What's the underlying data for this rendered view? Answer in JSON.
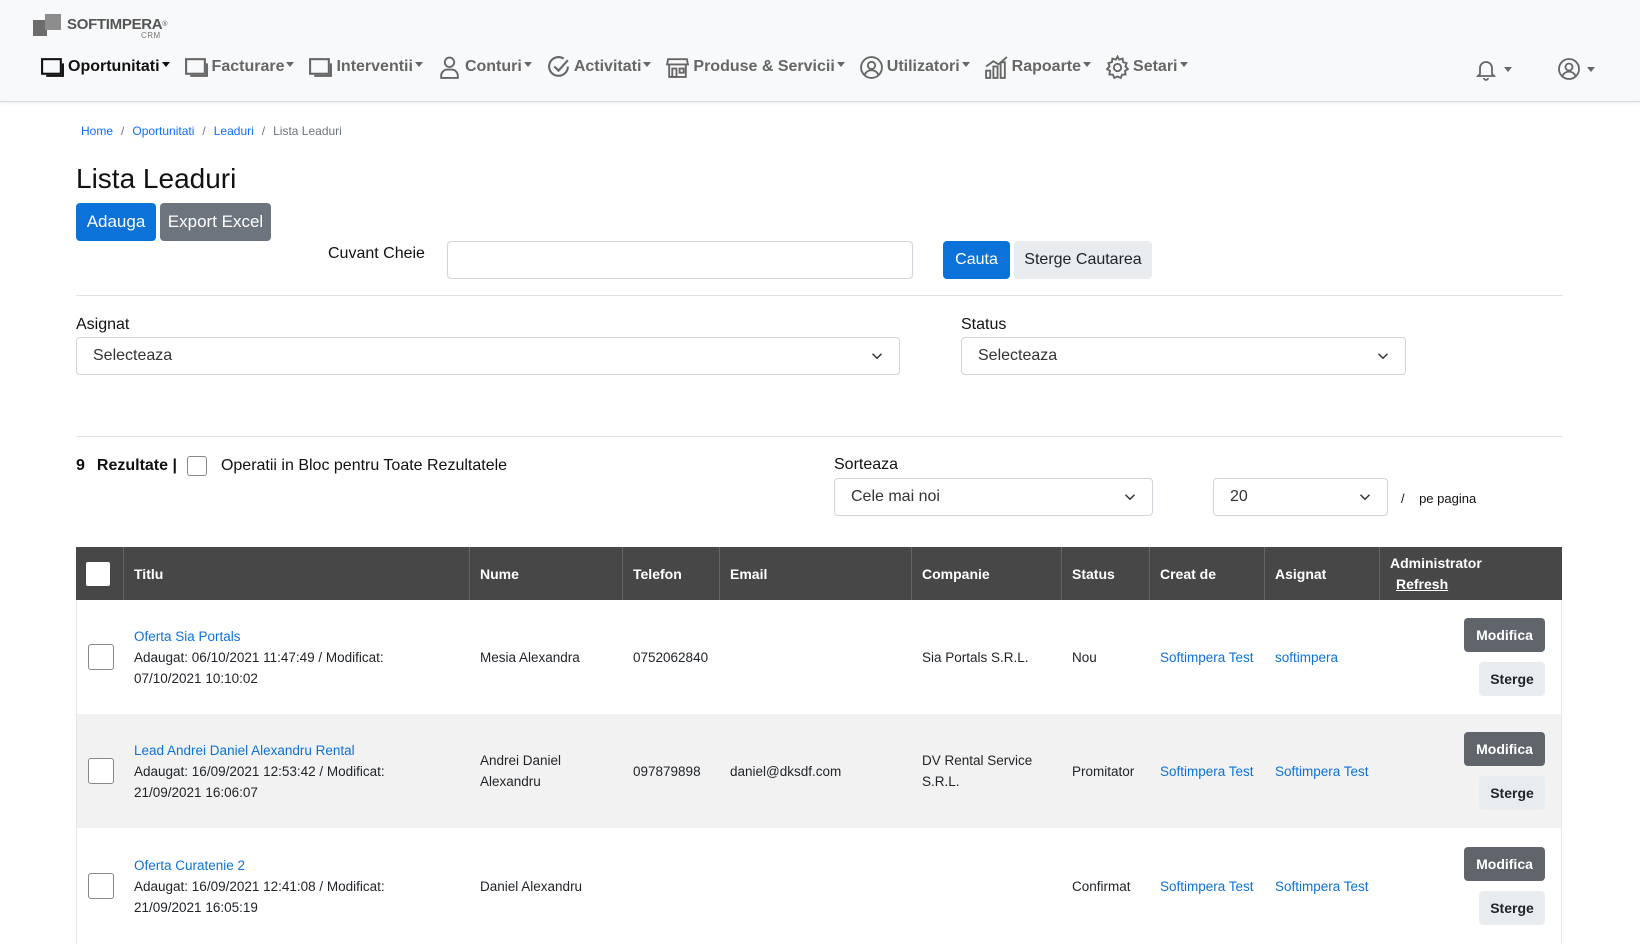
{
  "app": {
    "logo_text": "SOFTIMPERA",
    "logo_reg": "®",
    "logo_sub": "CRM"
  },
  "nav": {
    "items": [
      {
        "label": "Oportunitati",
        "icon": "window-icon",
        "active": true
      },
      {
        "label": "Facturare",
        "icon": "window-icon"
      },
      {
        "label": "Interventii",
        "icon": "window-icon"
      },
      {
        "label": "Conturi",
        "icon": "user-icon"
      },
      {
        "label": "Activitati",
        "icon": "check-circle-icon"
      },
      {
        "label": "Produse & Servicii",
        "icon": "shop-icon"
      },
      {
        "label": "Utilizatori",
        "icon": "user-circle-icon"
      },
      {
        "label": "Rapoarte",
        "icon": "chart-icon"
      },
      {
        "label": "Setari",
        "icon": "gear-icon"
      }
    ]
  },
  "breadcrumb": {
    "home": "Home",
    "oportunitati": "Oportunitati",
    "leaduri": "Leaduri",
    "current": "Lista Leaduri",
    "sep": "/"
  },
  "page": {
    "title": "Lista Leaduri",
    "add_label": "Adauga",
    "export_label": "Export Excel"
  },
  "search": {
    "label": "Cuvant Cheie",
    "value": "",
    "search_label": "Cauta",
    "clear_label": "Sterge Cautarea"
  },
  "filters": {
    "asignat_label": "Asignat",
    "asignat_value": "Selecteaza",
    "status_label": "Status",
    "status_value": "Selecteaza"
  },
  "results": {
    "count": "9",
    "label": "Rezultate |",
    "bulk_label": "Operatii in Bloc pentru Toate Rezultatele",
    "sort_label": "Sorteaza",
    "sort_value": "Cele mai noi",
    "per_page_value": "20",
    "per_page_sep": "/",
    "per_page_label": "pe pagina"
  },
  "table": {
    "headers": {
      "titlu": "Titlu",
      "nume": "Nume",
      "telefon": "Telefon",
      "email": "Email",
      "companie": "Companie",
      "status": "Status",
      "creat_de": "Creat de",
      "asignat": "Asignat",
      "administrator": "Administrator",
      "refresh": "Refresh"
    },
    "rows": [
      {
        "title": "Oferta Sia Portals",
        "meta1": "Adaugat: 06/10/2021 11:47:49 / Modificat:",
        "meta2": "07/10/2021 10:10:02",
        "nume": "Mesia Alexandra",
        "telefon": "0752062840",
        "email": "",
        "companie": "Sia Portals S.R.L.",
        "status": "Nou",
        "creat_de": "Softimpera Test",
        "asignat": "softimpera",
        "modify": "Modifica",
        "delete": "Sterge"
      },
      {
        "title": "Lead Andrei Daniel Alexandru Rental",
        "meta1": "Adaugat: 16/09/2021 12:53:42 / Modificat:",
        "meta2": "21/09/2021 16:06:07",
        "nume": "Andrei Daniel Alexandru",
        "telefon": "097879898",
        "email": "daniel@dksdf.com",
        "companie": "DV Rental Service S.R.L.",
        "status": "Promitator",
        "creat_de": "Softimpera Test",
        "asignat": "Softimpera Test",
        "modify": "Modifica",
        "delete": "Sterge"
      },
      {
        "title": "Oferta Curatenie 2",
        "meta1": "Adaugat: 16/09/2021 12:41:08 / Modificat:",
        "meta2": "21/09/2021 16:05:19",
        "nume": "Daniel Alexandru",
        "telefon": "",
        "email": "",
        "companie": "",
        "status": "Confirmat",
        "creat_de": "Softimpera Test",
        "asignat": "Softimpera Test",
        "modify": "Modifica",
        "delete": "Sterge"
      }
    ]
  }
}
